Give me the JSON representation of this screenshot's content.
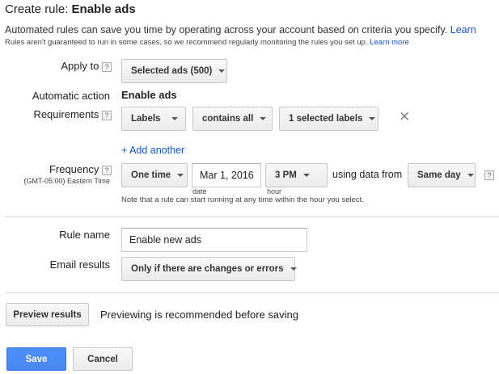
{
  "header": {
    "title_prefix": "Create rule: ",
    "title_name": "Enable ads",
    "intro_text": "Automated rules can save you time by operating across your account based on criteria you specify. ",
    "intro_link": "Learn",
    "sub_text": "Rules aren't guaranteed to run in some cases, so we recommend regularly monitoring the rules you set up. ",
    "sub_link": "Learn more"
  },
  "apply_to": {
    "label": "Apply to",
    "help": "?",
    "value": "Selected ads (500)"
  },
  "automatic_action": {
    "label": "Automatic action",
    "value": "Enable ads"
  },
  "requirements": {
    "label": "Requirements",
    "help": "?",
    "field": "Labels",
    "operator": "contains all",
    "value": "1 selected labels",
    "remove": "✕",
    "add_another": "+ Add another"
  },
  "frequency": {
    "label": "Frequency",
    "help": "?",
    "timezone": "(GMT-05:00) Eastern Time",
    "mode": "One time",
    "date": "Mar 1, 2016",
    "date_caption": "date",
    "hour": "3 PM",
    "hour_caption": "hour",
    "using_data_text": "using data from",
    "data_range": "Same day",
    "data_help": "?",
    "note": "Note that a rule can start running at any time within the hour you select."
  },
  "rule_name": {
    "label": "Rule name",
    "value": "Enable new ads"
  },
  "email_results": {
    "label": "Email results",
    "value": "Only if there are changes or errors"
  },
  "preview": {
    "button": "Preview results",
    "text": "Previewing is recommended before saving"
  },
  "actions": {
    "save": "Save",
    "cancel": "Cancel"
  }
}
